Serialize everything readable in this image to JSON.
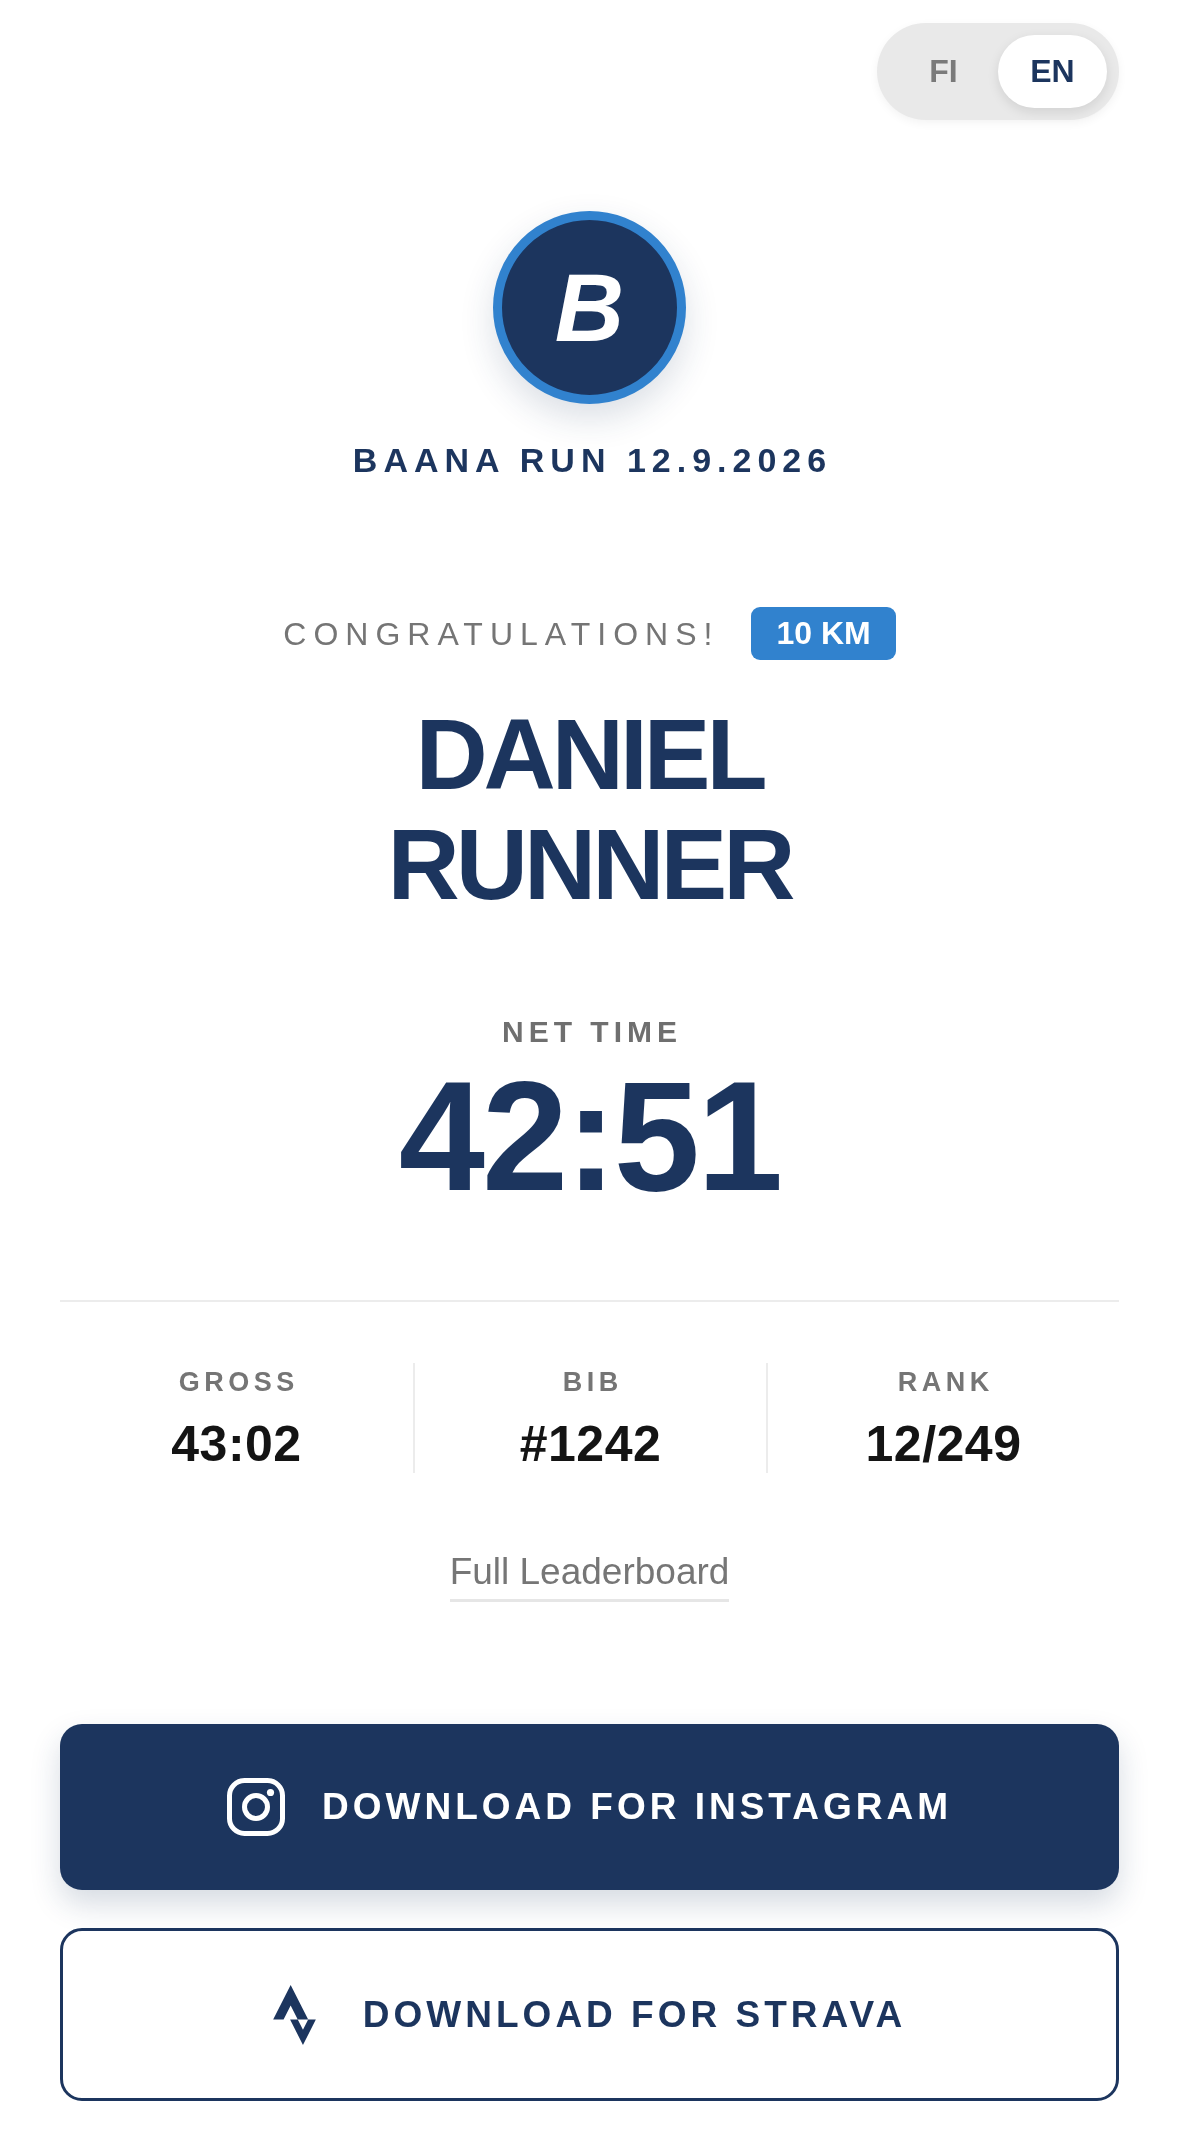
{
  "language_toggle": {
    "options": [
      {
        "label": "FI",
        "selected": false
      },
      {
        "label": "EN",
        "selected": true
      }
    ]
  },
  "header": {
    "logo_letter": "B",
    "event_title": "BAANA RUN 12.9.2026"
  },
  "result": {
    "greeting": "CONGRATULATIONS!",
    "distance_badge": "10 KM",
    "runner_name": "DANIEL RUNNER",
    "net_time": {
      "label": "NET TIME",
      "value": "42:51"
    }
  },
  "stats": [
    {
      "label": "GROSS",
      "value": "43:02"
    },
    {
      "label": "BIB",
      "value": "#1242"
    },
    {
      "label": "RANK",
      "value": "12/249"
    }
  ],
  "leaderboard_link": "Full Leaderboard",
  "download_buttons": [
    {
      "kind": "filled",
      "label": "DOWNLOAD FOR INSTAGRAM"
    },
    {
      "kind": "outlined",
      "label": "DOWNLOAD FOR STRAVA"
    }
  ]
}
